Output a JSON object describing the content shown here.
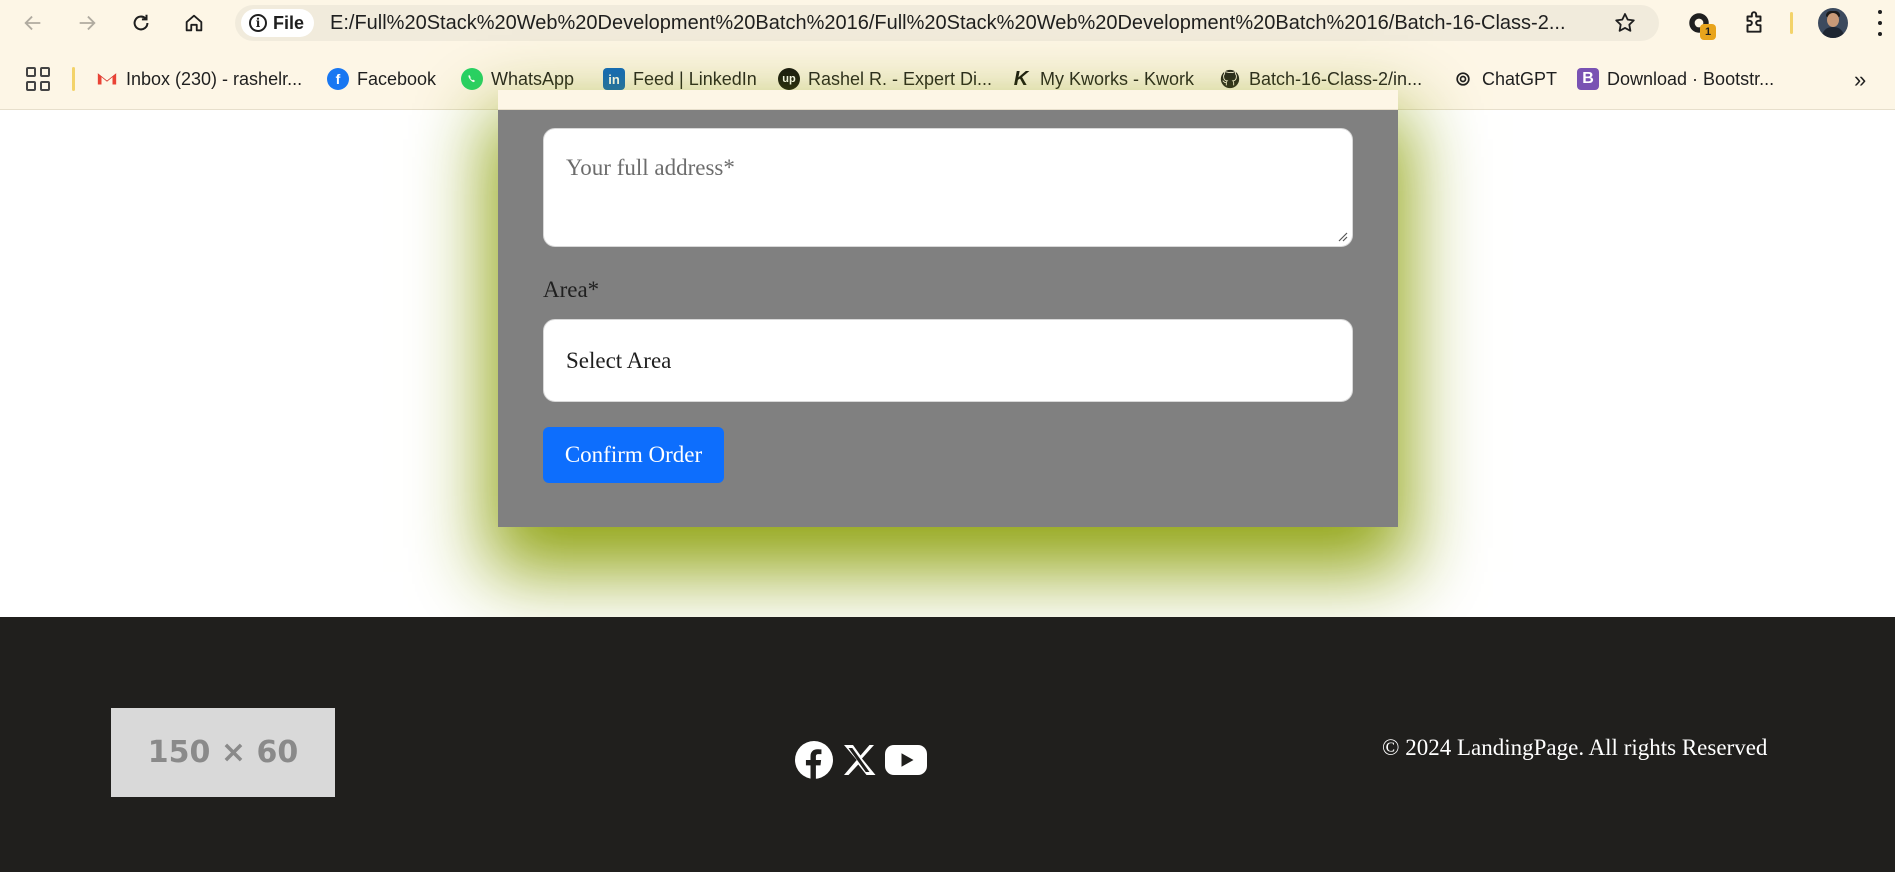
{
  "browser": {
    "url_chip_label": "File",
    "url": "E:/Full%20Stack%20Web%20Development%20Batch%2016/Full%20Stack%20Web%20Development%20Batch%2016/Batch-16-Class-2...",
    "extension_badge": "1",
    "icons": [
      "back-icon",
      "forward-icon",
      "reload-icon",
      "home-icon",
      "info-icon",
      "star-icon",
      "extensions-icon",
      "menu-icon"
    ]
  },
  "bookmarks": [
    {
      "label": "Inbox (230) - rashelr...",
      "icon": "gmail-icon"
    },
    {
      "label": "Facebook",
      "icon": "facebook-icon"
    },
    {
      "label": "WhatsApp",
      "icon": "whatsapp-icon"
    },
    {
      "label": "Feed | LinkedIn",
      "icon": "linkedin-icon"
    },
    {
      "label": "Rashel R. - Expert Di...",
      "icon": "upwork-icon"
    },
    {
      "label": "My Kworks - Kwork",
      "icon": "kwork-icon"
    },
    {
      "label": "Batch-16-Class-2/in...",
      "icon": "github-icon"
    },
    {
      "label": "ChatGPT",
      "icon": "chatgpt-icon"
    },
    {
      "label": "Download · Bootstr...",
      "icon": "bootstrap-icon"
    }
  ],
  "form": {
    "address_placeholder": "Your full address*",
    "area_label": "Area*",
    "area_select_value": "Select Area",
    "confirm_label": "Confirm Order"
  },
  "footer": {
    "logo_placeholder": "150 × 60",
    "social_icons": [
      "facebook-icon",
      "x-icon",
      "youtube-icon"
    ],
    "copyright": "© 2024 LandingPage. All rights Reserved"
  },
  "colors": {
    "primary_button": "#0d6efd",
    "card_background": "#808080",
    "card_glow": "#8ca00a",
    "footer_background": "#201f1d"
  }
}
